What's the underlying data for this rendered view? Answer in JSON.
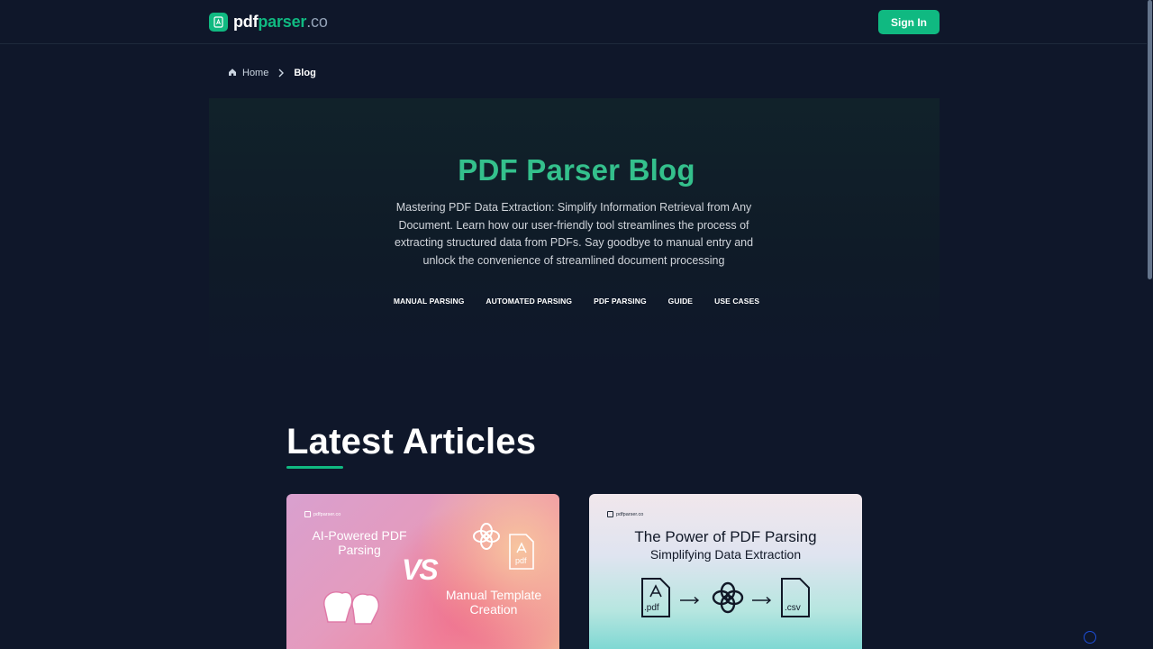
{
  "header": {
    "brand_pdf": "pdf",
    "brand_parser": "parser",
    "brand_tld": ".co",
    "signin_label": "Sign In"
  },
  "breadcrumb": {
    "home": "Home",
    "current": "Blog"
  },
  "hero": {
    "title": "PDF Parser Blog",
    "description": "Mastering PDF Data Extraction: Simplify Information Retrieval from Any Document. Learn how our user-friendly tool streamlines the process of extracting structured data from PDFs. Say goodbye to manual entry and unlock the convenience of streamlined document processing",
    "tags": [
      "MANUAL PARSING",
      "AUTOMATED PARSING",
      "PDF PARSING",
      "GUIDE",
      "USE CASES"
    ]
  },
  "latest": {
    "title": "Latest Articles"
  },
  "cards": [
    {
      "logo": "pdfparser.co",
      "title_line1": "AI-Powered PDF",
      "title_line2": "Parsing",
      "vs": "VS",
      "right_line1": "Manual Template",
      "right_line2": "Creation",
      "pdf_label": "pdf"
    },
    {
      "logo": "pdfparser.co",
      "title": "The Power of PDF Parsing",
      "subtitle": "Simplifying Data Extraction",
      "file1": ".pdf",
      "file2": ".csv"
    }
  ],
  "colors": {
    "background": "#0f172a",
    "accent": "#10b981",
    "hero_title": "#34c08c"
  }
}
